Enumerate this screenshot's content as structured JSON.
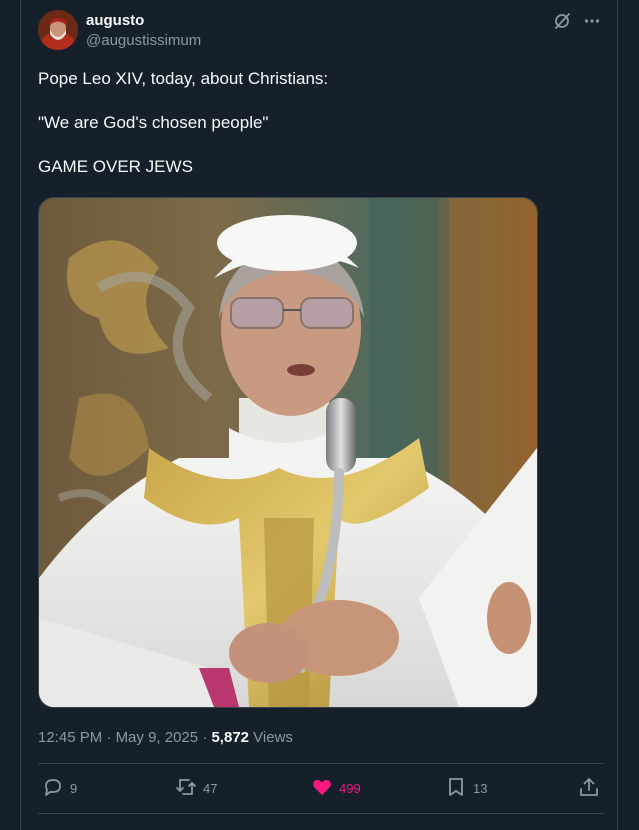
{
  "author": {
    "display_name": "augusto",
    "handle": "@augustissimum"
  },
  "tweet": {
    "lines": [
      "Pope Leo XIV, today, about Christians:",
      "\"We are God's chosen people\"",
      "GAME OVER JEWS"
    ]
  },
  "meta": {
    "time": "12:45 PM",
    "separator1": " · ",
    "date": "May 9, 2025",
    "separator2": " · ",
    "views_count": "5,872",
    "views_label": " Views"
  },
  "actions": {
    "replies": "9",
    "reposts": "47",
    "likes": "499",
    "bookmarks": "13"
  },
  "colors": {
    "background": "#15202b",
    "border": "#38444d",
    "text": "#f7f9f9",
    "muted": "#8b98a5",
    "like": "#f91880"
  },
  "icons": {
    "grok": "grok-icon",
    "more": "more-icon",
    "reply": "reply-icon",
    "repost": "repost-icon",
    "like": "heart-icon",
    "bookmark": "bookmark-icon",
    "share": "share-icon"
  }
}
